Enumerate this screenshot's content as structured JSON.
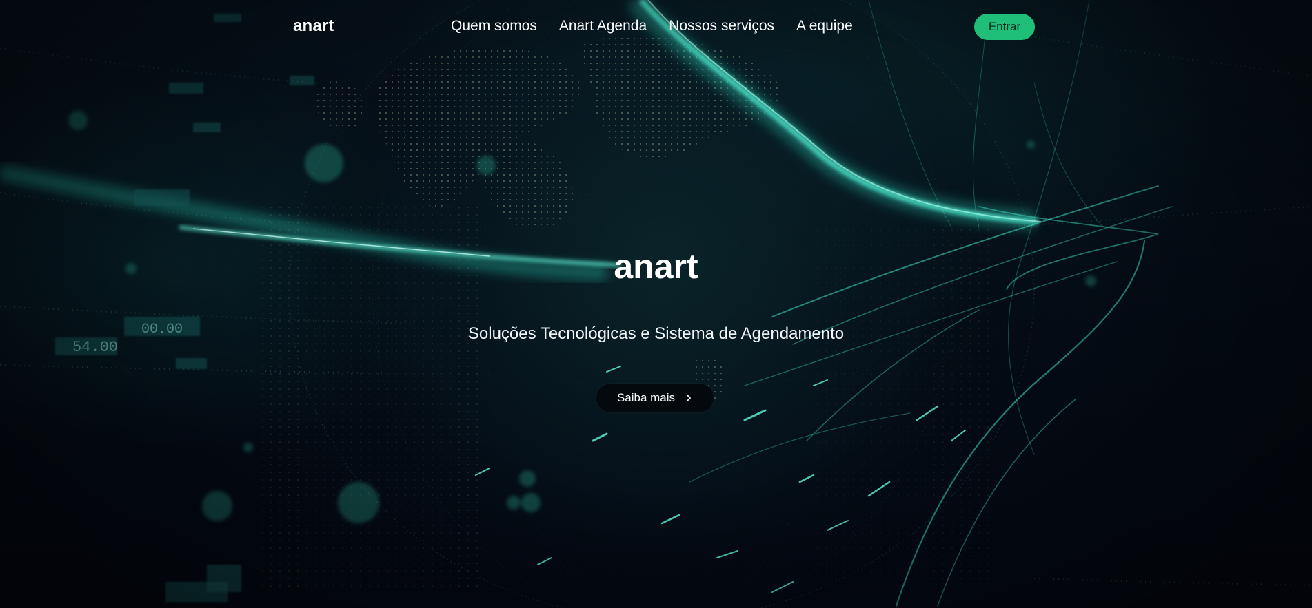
{
  "header": {
    "brand": "anart",
    "nav": [
      {
        "label": "Quem somos"
      },
      {
        "label": "Anart Agenda"
      },
      {
        "label": "Nossos serviços"
      },
      {
        "label": "A equipe"
      }
    ],
    "login_label": "Entrar"
  },
  "hero": {
    "title": "anart",
    "subtitle": "Soluções Tecnológicas e Sistema de Agendamento",
    "cta_label": "Saiba mais",
    "cta_icon": "chevron-right-icon"
  },
  "colors": {
    "accent": "#1fbf7a",
    "background": "#03080f",
    "glow": "#2ed3b7"
  }
}
